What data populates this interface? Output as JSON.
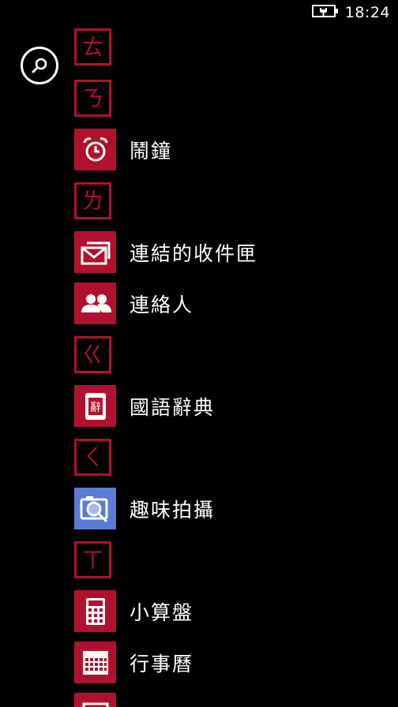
{
  "status_bar": {
    "time": "18:24",
    "battery_icon": "battery-charging-icon"
  },
  "search": {
    "icon": "search-icon"
  },
  "colors": {
    "accent": "#b0112e",
    "camera_tile": "#5b7bd5",
    "background": "#000000"
  },
  "apps_list": {
    "group_a": "ㄊ",
    "group_b": "ㄋ",
    "alarm": "鬧鐘",
    "group_c": "ㄌ",
    "linked_inbox": "連結的收件匣",
    "contacts": "連絡人",
    "group_d": "ㄍ",
    "dictionary": "國語辭典",
    "group_e": "ㄑ",
    "fun_camera": "趣味拍攝",
    "group_f": "ㄒ",
    "calculator": "小算盤",
    "calendar": "行事曆"
  }
}
